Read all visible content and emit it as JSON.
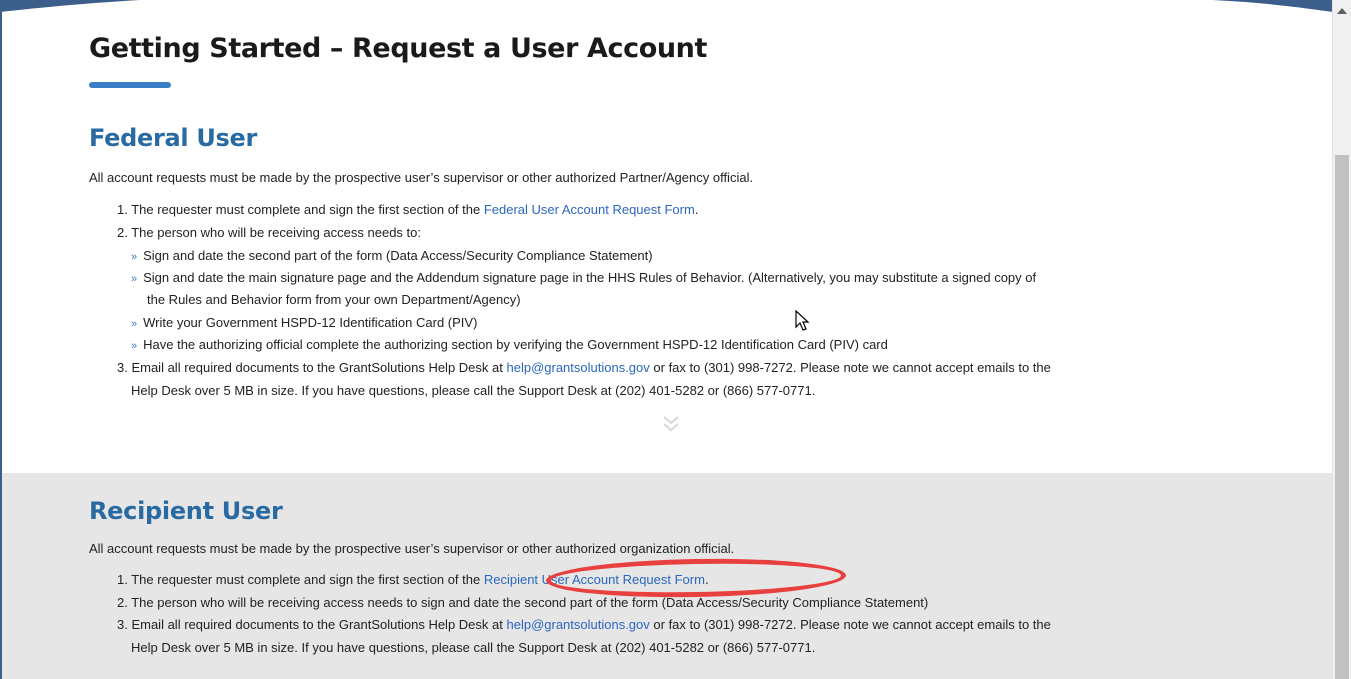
{
  "page": {
    "title": "Getting Started – Request a User Account"
  },
  "federal": {
    "heading": "Federal User",
    "intro": "All account requests must be made by the prospective user’s supervisor or other authorized Partner/Agency official.",
    "step1_prefix": "1. The requester must complete and sign the first section of the ",
    "step1_link": "Federal User Account Request Form",
    "step1_suffix": ".",
    "step2": "2. The person who will be receiving access needs to:",
    "sub_items": [
      "Sign and date the second part of the form (Data Access/Security Compliance Statement)",
      "Sign and date the main signature page and the Addendum signature page in the HHS Rules of Behavior. (Alternatively, you may substitute a signed copy of",
      "Write your Government HSPD-12 Identification Card (PIV)",
      "Have the authorizing official complete the authorizing section by verifying the Government HSPD-12 Identification Card (PIV) card"
    ],
    "sub_item2_cont": "the Rules and Behavior form from your own Department/Agency)",
    "step3_prefix": "3. Email all required documents to the GrantSolutions Help Desk at ",
    "step3_link": "help@grantsolutions.gov",
    "step3_suffix": " or fax to (301) 998-7272. Please note we cannot accept emails to the",
    "step3_cont": "Help Desk over 5 MB in size. If you have questions, please call the Support Desk at (202) 401-5282 or (866) 577-0771."
  },
  "recipient": {
    "heading": "Recipient User",
    "intro": "All account requests must be made by the prospective user’s supervisor or other authorized organization official.",
    "step1_prefix": "1. The requester must complete and sign the first section of the ",
    "step1_link": "Recipient User Account Request Form",
    "step1_suffix": ".",
    "step2": "2. The person who will be receiving access needs to sign and date the second part of the form (Data Access/Security Compliance Statement)",
    "step3_prefix": "3. Email all required documents to the GrantSolutions Help Desk at ",
    "step3_link": "help@grantsolutions.gov",
    "step3_suffix": " or fax to (301) 998-7272. Please note we cannot accept emails to the",
    "step3_cont": "Help Desk over 5 MB in size. If you have questions, please call the Support Desk at (202) 401-5282 or (866) 577-0771."
  },
  "icons": {
    "bullet": "»",
    "scroll_down": "chevron-double-down-icon"
  },
  "colors": {
    "heading_blue": "#2a6aa3",
    "link_blue": "#2b67c0",
    "underline_blue": "#3a7ec6",
    "gray_section": "#e6e6e6",
    "highlight_red": "#e8403e"
  }
}
